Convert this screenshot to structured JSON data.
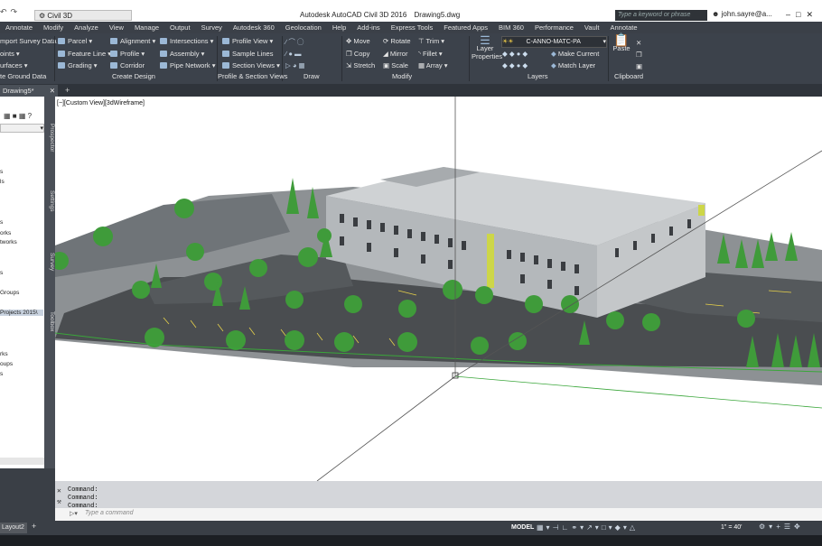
{
  "titlebar": {
    "workspace": "Civil 3D",
    "app_title": "Autodesk AutoCAD Civil 3D 2016",
    "doc_title": "Drawing5.dwg",
    "search_placeholder": "Type a keyword or phrase",
    "user": "john.sayre@a..."
  },
  "menu_tabs": [
    "Annotate",
    "Modify",
    "Analyze",
    "View",
    "Manage",
    "Output",
    "Survey",
    "Autodesk 360",
    "Geolocation",
    "Help",
    "Add-ins",
    "Express Tools",
    "Featured Apps",
    "BIM 360",
    "Performance",
    "Vault",
    "Annotate"
  ],
  "ribbon": {
    "ground_data": [
      "mport Survey Data",
      "oints",
      "urfaces"
    ],
    "create_design": [
      "Parcel",
      "Feature Line",
      "Grading",
      "Alignment",
      "Profile",
      "Corridor",
      "Intersections",
      "Assembly",
      "Pipe Network"
    ],
    "profile_section": [
      "Profile View",
      "Sample Lines",
      "Section Views"
    ],
    "modify_tools": [
      "Move",
      "Copy",
      "Stretch",
      "Rotate",
      "Mirror",
      "Scale",
      "Trim",
      "Fillet",
      "Array"
    ],
    "layers": {
      "layer_properties": "Layer Properties",
      "current_layer": "C-ANNO-MATC-PA",
      "make_current": "Make Current",
      "match_layer": "Match Layer"
    },
    "clipboard": {
      "paste": "Paste"
    },
    "panel_titles": [
      "te Ground Data",
      "Create Design",
      "Profile & Section Views",
      "Draw",
      "Modify",
      "Layers",
      "Clipboard"
    ]
  },
  "doc_tabs": {
    "active": "Drawing5*"
  },
  "palette": {
    "items": [
      "s",
      "ls",
      "s",
      "orks",
      "tworks",
      "s",
      "Groups",
      "Projects 2015\\",
      "rks",
      "oups",
      "s"
    ],
    "vertical_tabs": [
      "Prospector",
      "Settings",
      "Survey",
      "Toolbox"
    ]
  },
  "viewport": {
    "label": "[−][Custom View][3dWireframe]"
  },
  "command": {
    "history": [
      "Command:",
      "Command:",
      "Command:"
    ],
    "placeholder": "Type a command"
  },
  "statusbar": {
    "layout_tab": "Layout2",
    "model": "MODEL",
    "scale": "1\" = 40'"
  },
  "colors": {
    "accent": "#9bb8d6",
    "viewport_bg": "#ffffff",
    "ui_dark": "#3c424b",
    "building": "#b4b8bb",
    "tree": "#3f9b3a",
    "pavement": "#4a4d50"
  }
}
